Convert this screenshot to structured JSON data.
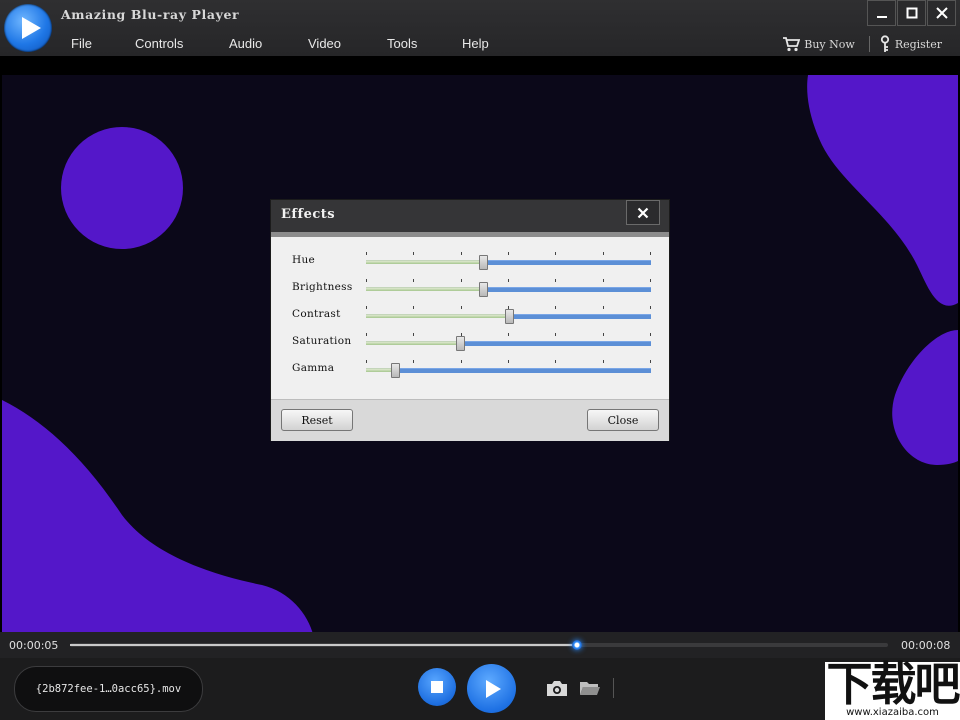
{
  "app": {
    "title": "Amazing Blu-ray Player"
  },
  "menu": [
    {
      "label": "File"
    },
    {
      "label": "Controls"
    },
    {
      "label": "Audio"
    },
    {
      "label": "Video"
    },
    {
      "label": "Tools"
    },
    {
      "label": "Help"
    }
  ],
  "header_links": {
    "buy_now": "Buy Now",
    "register": "Register"
  },
  "effects_dialog": {
    "title": "Effects",
    "sliders": [
      {
        "label": "Hue",
        "value_percent": 41
      },
      {
        "label": "Brightness",
        "value_percent": 41
      },
      {
        "label": "Contrast",
        "value_percent": 50
      },
      {
        "label": "Saturation",
        "value_percent": 33
      },
      {
        "label": "Gamma",
        "value_percent": 10
      }
    ],
    "reset_label": "Reset",
    "close_label": "Close"
  },
  "playback": {
    "elapsed": "00:00:05",
    "duration": "00:00:08",
    "progress_percent": 62,
    "filename": "{2b872fee-1…0acc65}.mov"
  },
  "watermark": {
    "text": "下载吧",
    "url": "www.xiazaiba.com"
  },
  "colors": {
    "accent_blue": "#1e71e4",
    "video_background": "#0b0819",
    "shape_purple": "#5417c9",
    "slider_track": "#5c8fd6"
  },
  "icons": {
    "logo": "play-logo-icon",
    "cart": "cart-icon",
    "register": "key-icon",
    "minimize": "minimize-icon",
    "maximize": "maximize-icon",
    "close": "close-icon",
    "stop": "stop-icon",
    "play": "play-icon",
    "snapshot": "camera-icon",
    "folder": "folder-icon"
  }
}
